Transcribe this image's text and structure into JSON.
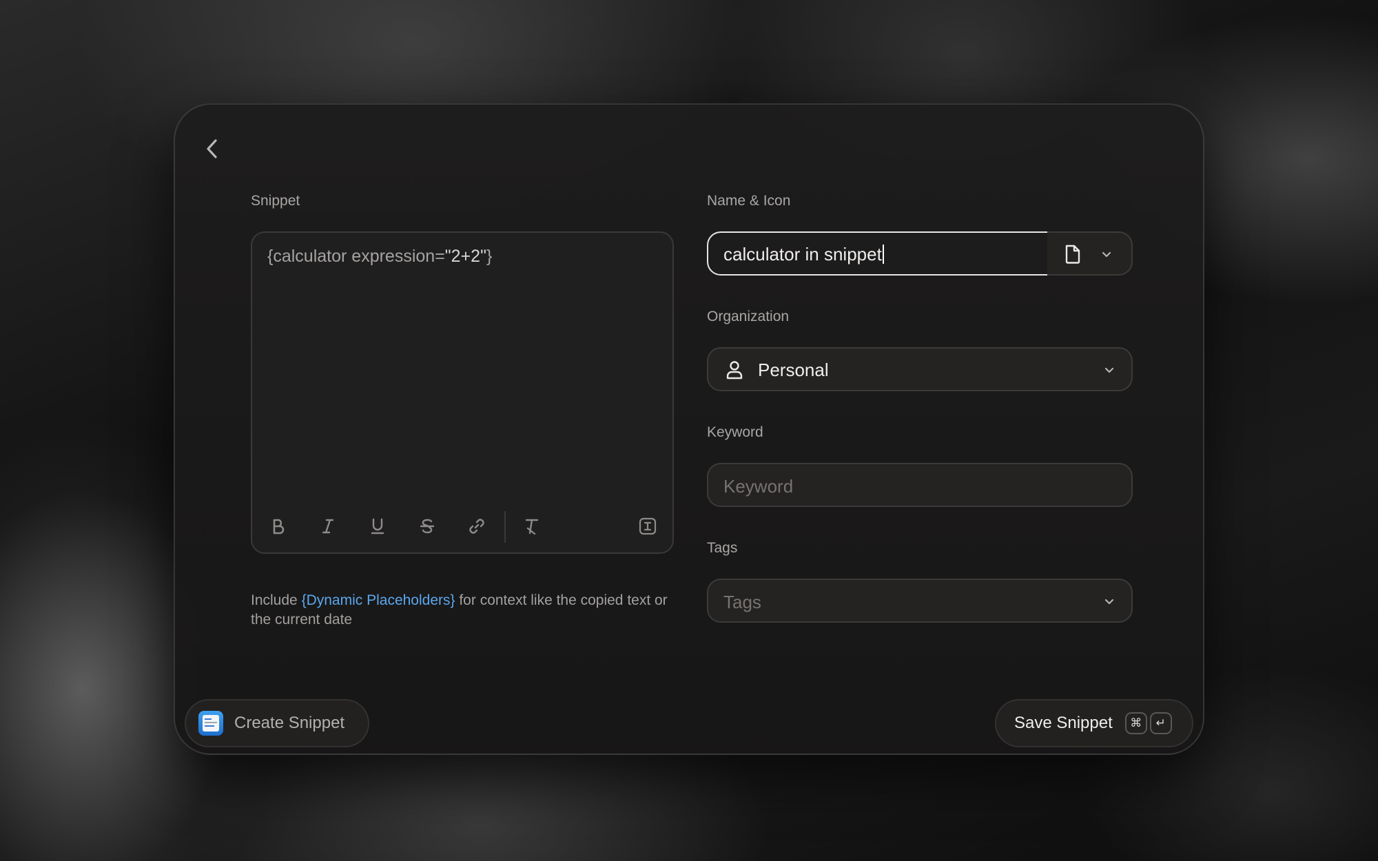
{
  "form": {
    "snippet_label": "Snippet",
    "snippet_text_before": "{calculator expression=",
    "snippet_text_quoted": "\"2+2\"",
    "snippet_text_after": "}",
    "help_prefix": "Include ",
    "help_link": "{Dynamic Placeholders}",
    "help_suffix": " for context like the copied text or the current date",
    "name_label": "Name & Icon",
    "name_value": "calculator in snippet",
    "organization_label": "Organization",
    "organization_value": "Personal",
    "keyword_label": "Keyword",
    "keyword_placeholder": "Keyword",
    "tags_label": "Tags",
    "tags_placeholder": "Tags"
  },
  "toolbar": {
    "icons": [
      "bold-icon",
      "italic-icon",
      "underline-icon",
      "strikethrough-icon",
      "link-icon",
      "clear-format-icon",
      "insert-placeholder-icon"
    ]
  },
  "footer": {
    "command_name": "Create Snippet",
    "action_label": "Save Snippet",
    "shortcut_modifier": "⌘",
    "shortcut_key": "↵"
  },
  "colors": {
    "accent_link": "#5aa7ee",
    "app_icon": "#2f8ae6"
  }
}
